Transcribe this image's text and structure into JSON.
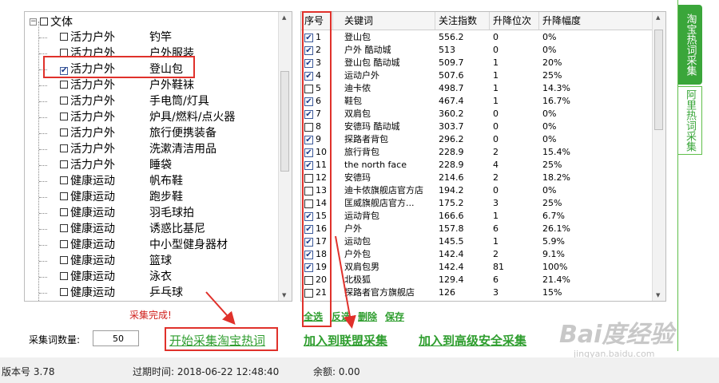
{
  "tree": {
    "root_label": "文体",
    "expander_symbol": "−",
    "rows": [
      {
        "category": "活力户外",
        "sub": "钓竿",
        "checked": false
      },
      {
        "category": "活力户外",
        "sub": "户外服装",
        "checked": false
      },
      {
        "category": "活力户外",
        "sub": "登山包",
        "checked": true
      },
      {
        "category": "活力户外",
        "sub": "户外鞋袜",
        "checked": false
      },
      {
        "category": "活力户外",
        "sub": "手电筒/灯具",
        "checked": false
      },
      {
        "category": "活力户外",
        "sub": "炉具/燃料/点火器",
        "checked": false
      },
      {
        "category": "活力户外",
        "sub": "旅行便携装备",
        "checked": false
      },
      {
        "category": "活力户外",
        "sub": "洗漱清洁用品",
        "checked": false
      },
      {
        "category": "活力户外",
        "sub": "睡袋",
        "checked": false
      },
      {
        "category": "健康运动",
        "sub": "帆布鞋",
        "checked": false
      },
      {
        "category": "健康运动",
        "sub": "跑步鞋",
        "checked": false
      },
      {
        "category": "健康运动",
        "sub": "羽毛球拍",
        "checked": false
      },
      {
        "category": "健康运动",
        "sub": "诱惑比基尼",
        "checked": false
      },
      {
        "category": "健康运动",
        "sub": "中小型健身器材",
        "checked": false
      },
      {
        "category": "健康运动",
        "sub": "篮球",
        "checked": false
      },
      {
        "category": "健康运动",
        "sub": "泳衣",
        "checked": false
      },
      {
        "category": "健康运动",
        "sub": "乒乓球",
        "checked": false
      }
    ]
  },
  "table": {
    "headers": [
      "序号",
      "关键词",
      "关注指数",
      "升降位次",
      "升降幅度"
    ],
    "rows": [
      {
        "idx": "1",
        "checked": true,
        "keyword": "登山包",
        "index": "556.2",
        "rank": "0",
        "change": "0%"
      },
      {
        "idx": "2",
        "checked": true,
        "keyword": "户外 酷动城",
        "index": "513",
        "rank": "0",
        "change": "0%"
      },
      {
        "idx": "3",
        "checked": true,
        "keyword": "登山包 酷动城",
        "index": "509.7",
        "rank": "1",
        "change": "20%"
      },
      {
        "idx": "4",
        "checked": true,
        "keyword": "运动户外",
        "index": "507.6",
        "rank": "1",
        "change": "25%"
      },
      {
        "idx": "5",
        "checked": false,
        "keyword": "迪卡侬",
        "index": "498.7",
        "rank": "1",
        "change": "14.3%"
      },
      {
        "idx": "6",
        "checked": true,
        "keyword": "鞋包",
        "index": "467.4",
        "rank": "1",
        "change": "16.7%"
      },
      {
        "idx": "7",
        "checked": true,
        "keyword": "双肩包",
        "index": "360.2",
        "rank": "0",
        "change": "0%"
      },
      {
        "idx": "8",
        "checked": false,
        "keyword": "安德玛 酷动城",
        "index": "303.7",
        "rank": "0",
        "change": "0%"
      },
      {
        "idx": "9",
        "checked": true,
        "keyword": "探路者背包",
        "index": "296.2",
        "rank": "0",
        "change": "0%"
      },
      {
        "idx": "10",
        "checked": true,
        "keyword": "旅行背包",
        "index": "228.9",
        "rank": "2",
        "change": "15.4%"
      },
      {
        "idx": "11",
        "checked": true,
        "keyword": "the north face",
        "index": "228.9",
        "rank": "4",
        "change": "25%"
      },
      {
        "idx": "12",
        "checked": false,
        "keyword": "安德玛",
        "index": "214.6",
        "rank": "2",
        "change": "18.2%"
      },
      {
        "idx": "13",
        "checked": false,
        "keyword": "迪卡侬旗舰店官方店",
        "index": "194.2",
        "rank": "0",
        "change": "0%"
      },
      {
        "idx": "14",
        "checked": false,
        "keyword": "匡威旗舰店官方...",
        "index": "175.2",
        "rank": "3",
        "change": "25%"
      },
      {
        "idx": "15",
        "checked": true,
        "keyword": "运动背包",
        "index": "166.6",
        "rank": "1",
        "change": "6.7%"
      },
      {
        "idx": "16",
        "checked": true,
        "keyword": "户外",
        "index": "157.8",
        "rank": "6",
        "change": "26.1%"
      },
      {
        "idx": "17",
        "checked": true,
        "keyword": "运动包",
        "index": "145.5",
        "rank": "1",
        "change": "5.9%"
      },
      {
        "idx": "18",
        "checked": true,
        "keyword": "户外包",
        "index": "142.4",
        "rank": "2",
        "change": "9.1%"
      },
      {
        "idx": "19",
        "checked": true,
        "keyword": "双肩包男",
        "index": "142.4",
        "rank": "81",
        "change": "100%"
      },
      {
        "idx": "20",
        "checked": false,
        "keyword": "北极狐",
        "index": "129.4",
        "rank": "6",
        "change": "21.4%"
      },
      {
        "idx": "21",
        "checked": false,
        "keyword": "探路者官方旗舰店",
        "index": "126",
        "rank": "3",
        "change": "15%"
      }
    ]
  },
  "table_actions": {
    "select_all": "全选",
    "invert": "反选",
    "delete": "删除",
    "save": "保存"
  },
  "side_tabs": {
    "tab1": "淘宝热词采集",
    "tab2": "阿里热词采集"
  },
  "bottom": {
    "done_msg": "采集完成!",
    "count_label": "采集词数量:",
    "count_value": "50",
    "start_button": "开始采集淘宝热词",
    "add_union": "加入到联盟采集",
    "add_secure": "加入到高级安全采集"
  },
  "status": {
    "version": "版本号 3.78",
    "expire": "过期时间: 2018-06-22 12:48:40",
    "balance": "余额: 0.00"
  },
  "watermark": {
    "brand": "Bai度经验",
    "url": "jingyan.baidu.com"
  },
  "colors": {
    "accent_green": "#2f9e2f",
    "annotation_red": "#e0312b"
  }
}
